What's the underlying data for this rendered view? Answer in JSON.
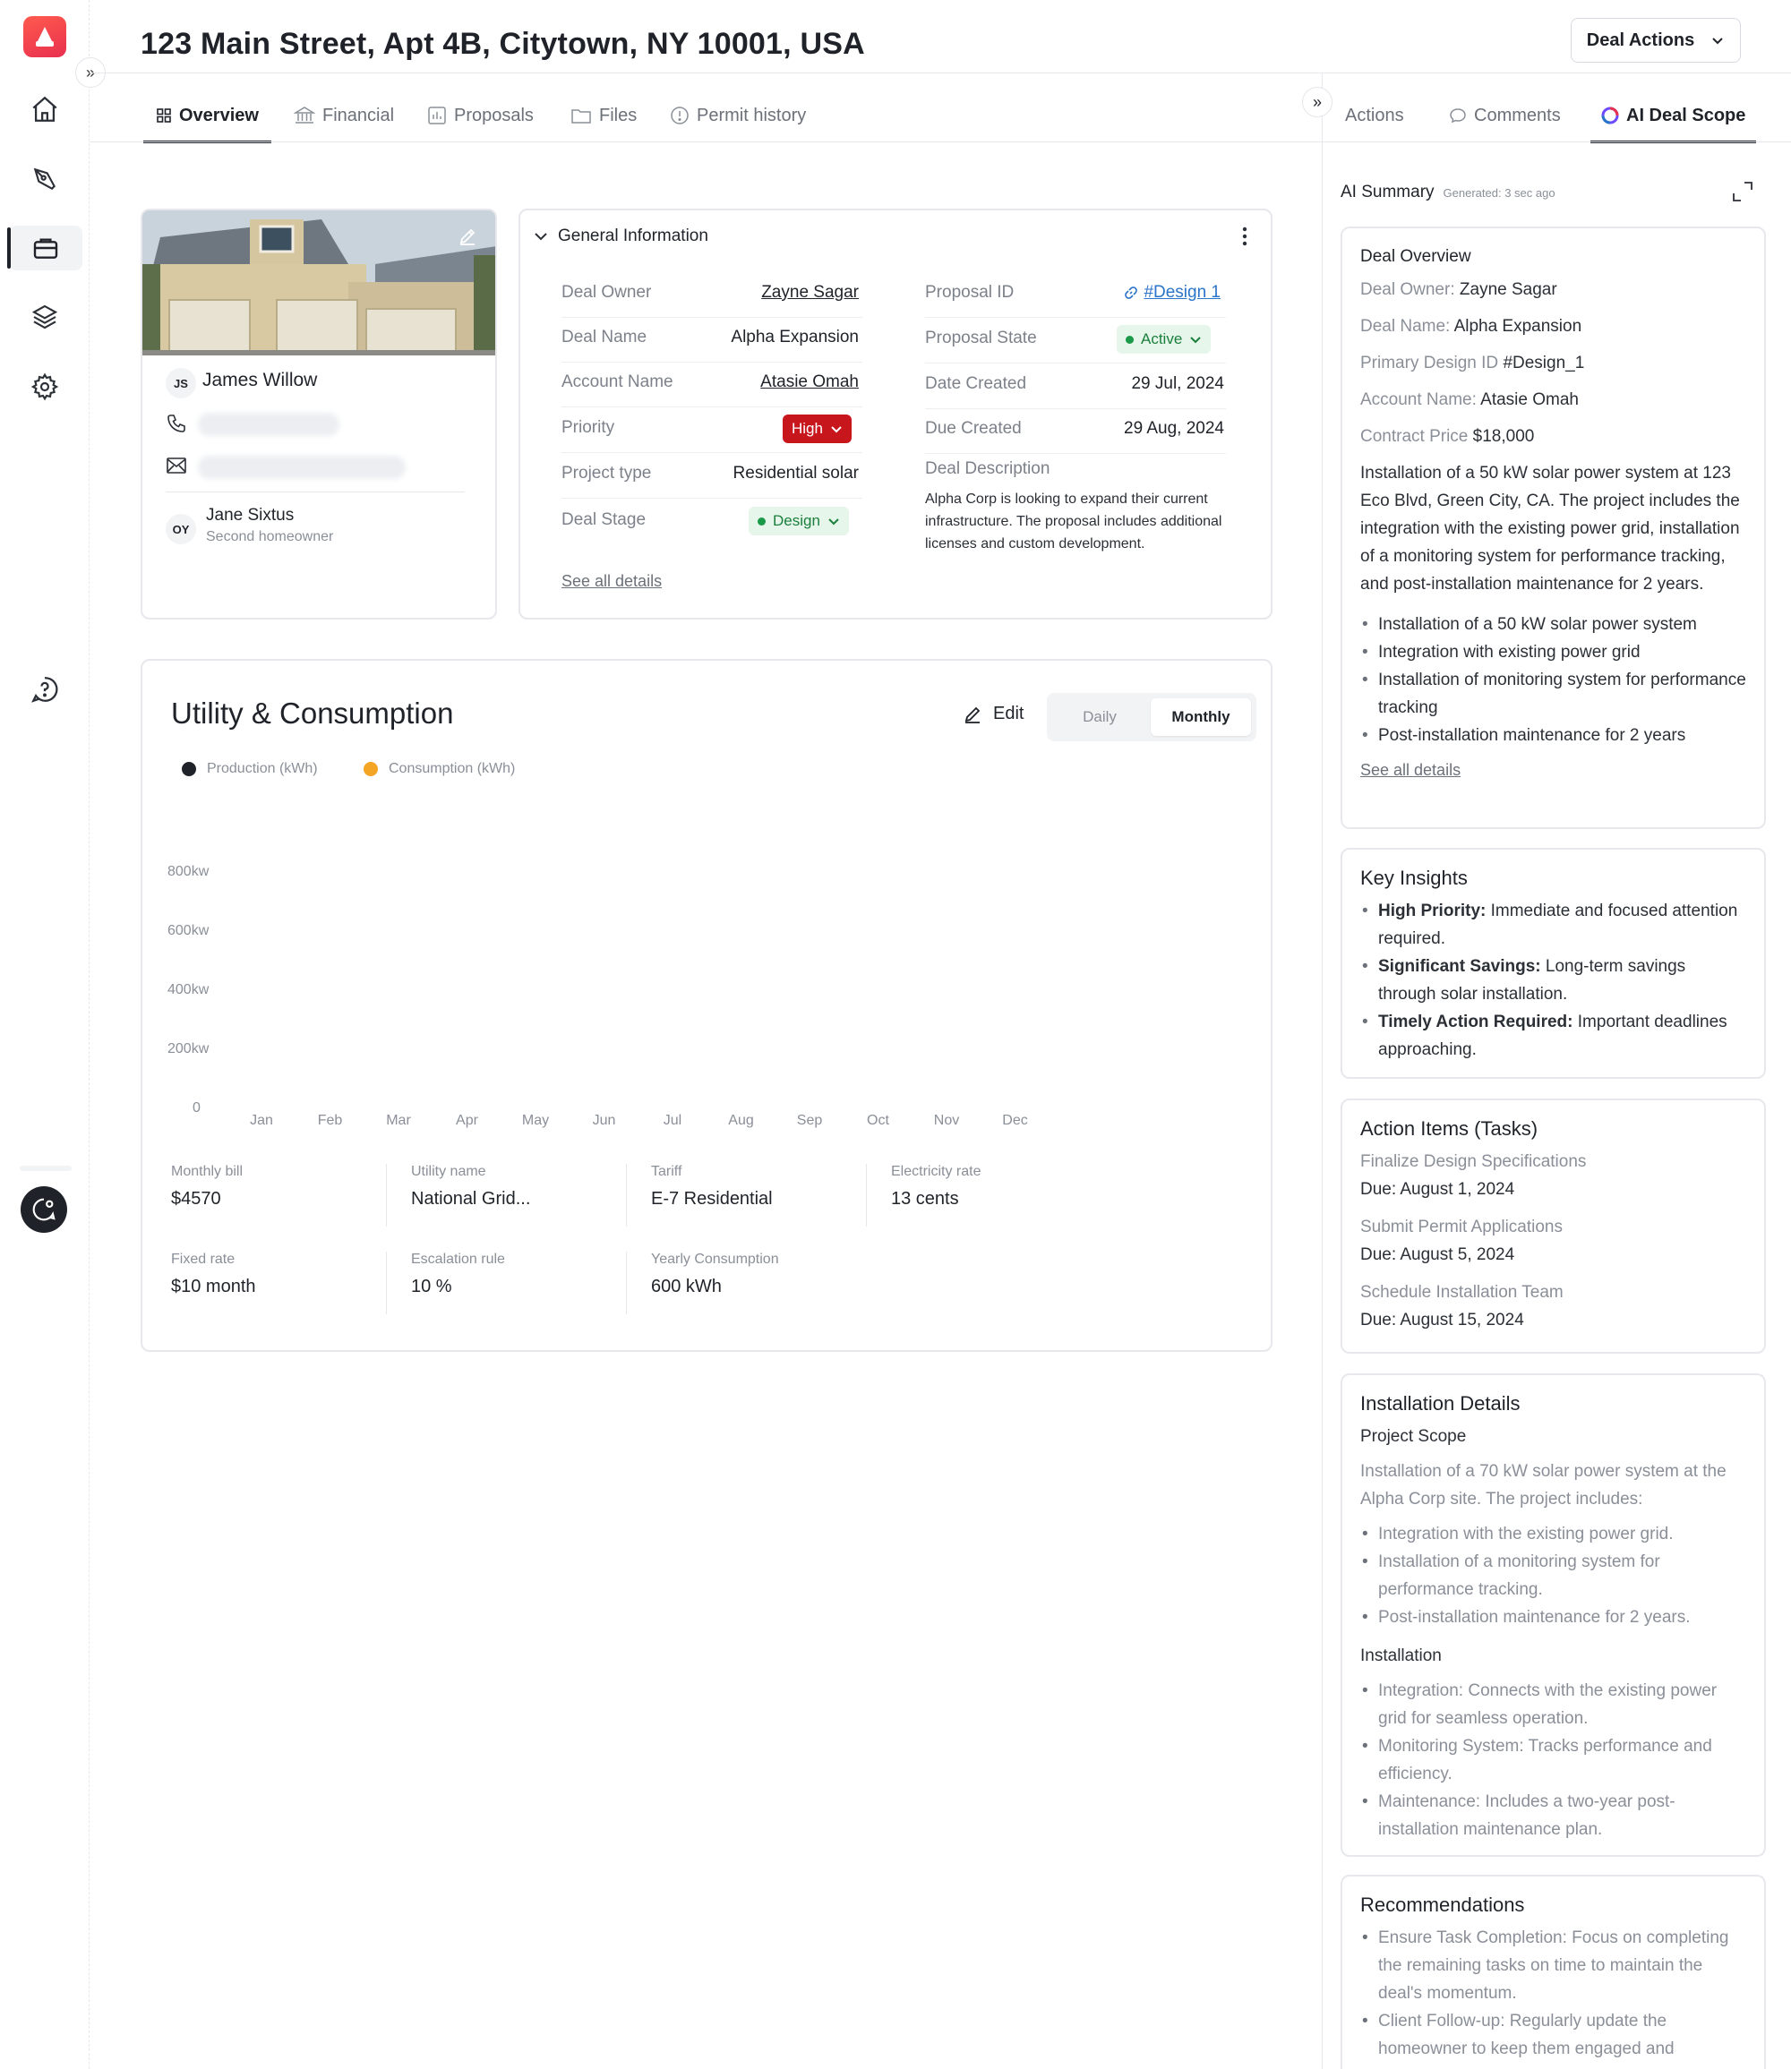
{
  "header": {
    "title": "123 Main Street, Apt 4B, Citytown, NY 10001, USA",
    "deal_actions": "Deal Actions"
  },
  "tabs": [
    {
      "label": "Overview",
      "icon": "grid-icon",
      "active": true
    },
    {
      "label": "Financial",
      "icon": "bank-icon"
    },
    {
      "label": "Proposals",
      "icon": "chart-icon"
    },
    {
      "label": "Files",
      "icon": "folder-icon"
    },
    {
      "label": "Permit history",
      "icon": "info-icon"
    }
  ],
  "right_tabs": [
    {
      "label": "Actions"
    },
    {
      "label": "Comments",
      "icon": "comment-icon"
    },
    {
      "label": "AI Deal Scope",
      "icon": "ai-icon",
      "active": true
    }
  ],
  "contact": {
    "primary_initials": "JS",
    "primary_name": "James Willow",
    "secondary_initials": "OY",
    "secondary_name": "Jane Sixtus",
    "secondary_role": "Second homeowner"
  },
  "general_info": {
    "title": "General Information",
    "left": [
      {
        "label": "Deal Owner",
        "value": "Zayne Sagar"
      },
      {
        "label": "Deal Name",
        "value": "Alpha Expansion"
      },
      {
        "label": "Account Name",
        "value": "Atasie Omah"
      },
      {
        "label": "Priority",
        "value": "High"
      },
      {
        "label": "Project type",
        "value": "Residential solar"
      },
      {
        "label": "Deal Stage",
        "value": "Design"
      }
    ],
    "right": [
      {
        "label": "Proposal ID",
        "value": "#Design 1"
      },
      {
        "label": "Proposal State",
        "value": "Active"
      },
      {
        "label": "Date Created",
        "value": "29 Jul, 2024"
      },
      {
        "label": "Due Created",
        "value": "29 Aug, 2024"
      }
    ],
    "description_label": "Deal Description",
    "description": "Alpha Corp is looking to expand their current infrastructure. The proposal includes additional licenses and custom development.",
    "see_all": "See all details"
  },
  "utility": {
    "title": "Utility & Consumption",
    "edit": "Edit",
    "toggle": {
      "daily": "Daily",
      "monthly": "Monthly",
      "selected": "Monthly"
    },
    "meta": [
      {
        "label": "Monthly bill",
        "value": "$4570"
      },
      {
        "label": "Utility name",
        "value": "National Grid..."
      },
      {
        "label": "Tariff",
        "value": "E-7 Residential"
      },
      {
        "label": "Electricity rate",
        "value": "13 cents"
      },
      {
        "label": "Fixed rate",
        "value": "$10 month"
      },
      {
        "label": "Escalation rule",
        "value": "10 %"
      },
      {
        "label": "Yearly Consumption",
        "value": "600 kWh"
      }
    ]
  },
  "chart_data": {
    "type": "bar",
    "categories": [
      "Jan",
      "Feb",
      "Mar",
      "Apr",
      "May",
      "Jun",
      "Jul",
      "Aug",
      "Sep",
      "Oct",
      "Nov",
      "Dec"
    ],
    "series": [
      {
        "name": "Production (kWh)",
        "color": "#1f2329",
        "values": []
      },
      {
        "name": "Consumption (kWh)",
        "color": "#f5a524",
        "values": []
      }
    ],
    "y_ticks": [
      "800kw",
      "600kw",
      "400kw",
      "200kw",
      "0"
    ],
    "ylim": [
      0,
      800
    ],
    "legend": "top-left",
    "grid": false
  },
  "ai": {
    "summary_label": "AI Summary",
    "generated": "Generated: 3 sec ago",
    "overview": {
      "title": "Deal Overview",
      "fields": [
        {
          "label": "Deal Owner:",
          "value": "Zayne Sagar"
        },
        {
          "label": "Deal Name:",
          "value": "Alpha Expansion"
        },
        {
          "label": "Primary Design ID",
          "value": "#Design_1"
        },
        {
          "label": "Account Name:",
          "value": "Atasie Omah"
        },
        {
          "label": "Contract Price",
          "value": "$18,000"
        }
      ],
      "paragraph": "Installation of a 50 kW solar power system at 123 Eco Blvd, Green City, CA. The project includes the integration with the existing power grid, installation of a monitoring system for performance tracking, and post-installation maintenance for 2 years.",
      "bullets": [
        "Installation of a 50 kW solar power system",
        "Integration with existing power grid",
        "Installation of monitoring system for performance tracking",
        "Post-installation maintenance for 2 years"
      ],
      "see_all": "See all details"
    },
    "insights": {
      "title": "Key Insights",
      "items": [
        {
          "bold": "High Priority:",
          "text": "Immediate and focused attention required."
        },
        {
          "bold": "Significant Savings:",
          "text": "Long-term savings through solar installation."
        },
        {
          "bold": "Timely Action Required:",
          "text": "Important deadlines approaching."
        }
      ]
    },
    "actions": {
      "title": "Action Items (Tasks)",
      "items": [
        {
          "task": "Finalize Design Specifications",
          "due": "Due: August 1, 2024"
        },
        {
          "task": "Submit Permit Applications",
          "due": "Due: August 5, 2024"
        },
        {
          "task": "Schedule Installation Team",
          "due": "Due: August 15, 2024"
        }
      ]
    },
    "installation": {
      "title": "Installation Details",
      "scope_title": "Project Scope",
      "scope_text": "Installation of a 70 kW solar power system at the Alpha Corp site. The project includes:",
      "scope_bullets": [
        "Integration with the existing power grid.",
        "Installation of a monitoring system for performance tracking.",
        "Post-installation maintenance for 2 years."
      ],
      "install_title": "Installation",
      "install_bullets": [
        "Integration: Connects with the existing power grid for seamless operation.",
        "Monitoring System: Tracks performance and efficiency.",
        "Maintenance: Includes a two-year post-installation maintenance plan."
      ]
    },
    "recommendations": {
      "title": "Recommendations",
      "bullets": [
        "Ensure Task Completion: Focus on completing the remaining tasks on time to maintain the deal's momentum.",
        "Client Follow-up: Regularly update the homeowner to keep them engaged and"
      ]
    }
  }
}
